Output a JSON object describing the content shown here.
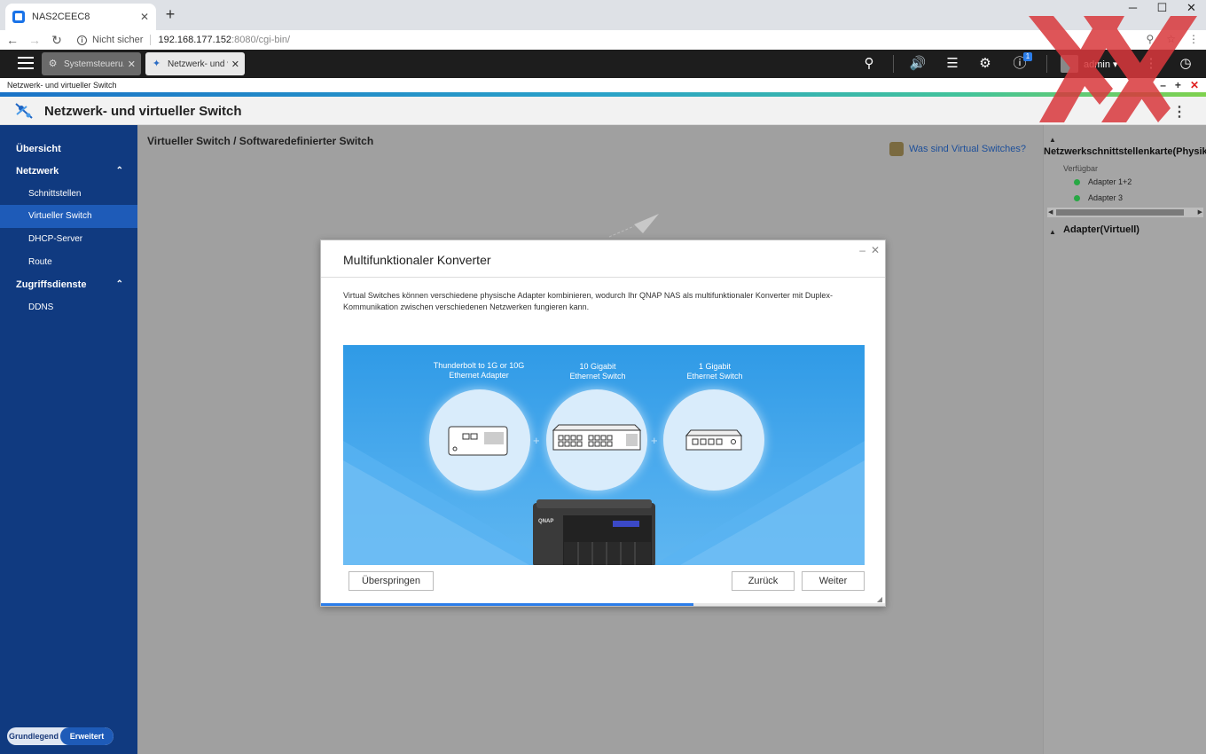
{
  "browser": {
    "tab_title": "NAS2CEEC8",
    "tab_close": "✕",
    "new_tab": "+",
    "win_min": "─",
    "win_max": "☐",
    "win_close": "✕",
    "security_text": "Nicht sicher",
    "url_host": "192.168.177.152",
    "url_rest": ":8080/cgi-bin/"
  },
  "qts": {
    "tabs": [
      {
        "label": "Systemsteueru...",
        "icon": "gear-icon"
      },
      {
        "label": "Netzwerk- und v...",
        "icon": "network-switch-icon"
      }
    ],
    "notification_count": "1",
    "user": "admin ▾"
  },
  "app": {
    "strip_title": "Netzwerk- und virtueller Switch",
    "title": "Netzwerk- und virtueller Switch"
  },
  "sidebar": {
    "items": [
      {
        "label": "Übersicht"
      },
      {
        "label": "Netzwerk"
      },
      {
        "label": "Schnittstellen"
      },
      {
        "label": "Virtueller Switch"
      },
      {
        "label": "DHCP-Server"
      },
      {
        "label": "Route"
      },
      {
        "label": "Zugriffsdienste"
      },
      {
        "label": "DDNS"
      }
    ],
    "mode_basic": "Grundlegend",
    "mode_advanced": "Erweitert"
  },
  "main": {
    "breadcrumb": "Virtueller Switch / Softwaredefinierter Switch",
    "help_link": "Was sind Virtual Switches?"
  },
  "right_panel": {
    "section1": "Netzwerkschnittstellenkarte(Physikalisch)",
    "available_label": "Verfügbar",
    "adapters": [
      "Adapter 1+2",
      "Adapter 3"
    ],
    "section2": "Adapter(Virtuell)"
  },
  "modal": {
    "title": "Multifunktionaler Konverter",
    "description": "Virtual Switches können verschiedene physische Adapter kombinieren, wodurch Ihr QNAP NAS als multifunktionaler Konverter mit Duplex-Kommunikation zwischen verschiedenen Netzwerken fungieren kann.",
    "illustration": {
      "label1_line1": "Thunderbolt to 1G or 10G",
      "label1_line2": "Ethernet Adapter",
      "label2_line1": "10 Gigabit",
      "label2_line2": "Ethernet Switch",
      "label3_line1": "1 Gigabit",
      "label3_line2": "Ethernet Switch",
      "nas_brand": "QNAP"
    },
    "skip_button": "Überspringen",
    "back_button": "Zurück",
    "next_button": "Weiter",
    "progress_percent": 66
  }
}
